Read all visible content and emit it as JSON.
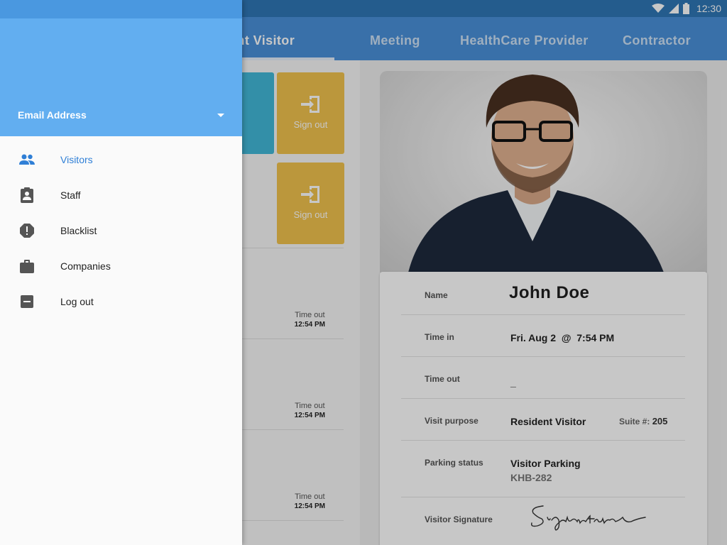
{
  "status_bar": {
    "time": "12:30"
  },
  "tabs": [
    {
      "label": "Resident Visitor"
    },
    {
      "label": "Meeting"
    },
    {
      "label": "HealthCare Provider"
    },
    {
      "label": "Contractor"
    }
  ],
  "visitor_list": {
    "sign_out_label": "Sign out",
    "rows": [
      {
        "time_out_label": "Time out",
        "time_out": "12:54 PM"
      },
      {
        "time_out_label": "Time out",
        "time_out": "12:54 PM"
      },
      {
        "time_out_label": "Time out",
        "time_out": "12:54 PM"
      }
    ]
  },
  "details": {
    "name_label": "Name",
    "name": "John Doe",
    "time_in_label": "Time in",
    "time_in": "Fri. Aug 2  @  7:54 PM",
    "time_out_label": "Time out",
    "time_out": "_",
    "purpose_label": "Visit purpose",
    "purpose": "Resident Visitor",
    "suite_label": "Suite #:",
    "suite": "205",
    "parking_label": "Parking status",
    "parking": "Visitor Parking",
    "plate": "KHB-282",
    "signature_label": "Visitor Signature",
    "signature": "Signature"
  },
  "drawer": {
    "account": "Email Address",
    "items": [
      {
        "label": "Visitors",
        "icon": "people-icon",
        "active": true
      },
      {
        "label": "Staff",
        "icon": "badge-icon",
        "active": false
      },
      {
        "label": "Blacklist",
        "icon": "alert-octagon-icon",
        "active": false
      },
      {
        "label": "Companies",
        "icon": "briefcase-icon",
        "active": false
      },
      {
        "label": "Log out",
        "icon": "minus-box-icon",
        "active": false
      }
    ]
  },
  "colors": {
    "primary": "#4a90d9",
    "status_bar": "#2f76b5",
    "drawer_header": "#62aef0",
    "active_card": "#42b8d8",
    "sign_out": "#f0c24e",
    "active_nav": "#2f7fd6"
  }
}
